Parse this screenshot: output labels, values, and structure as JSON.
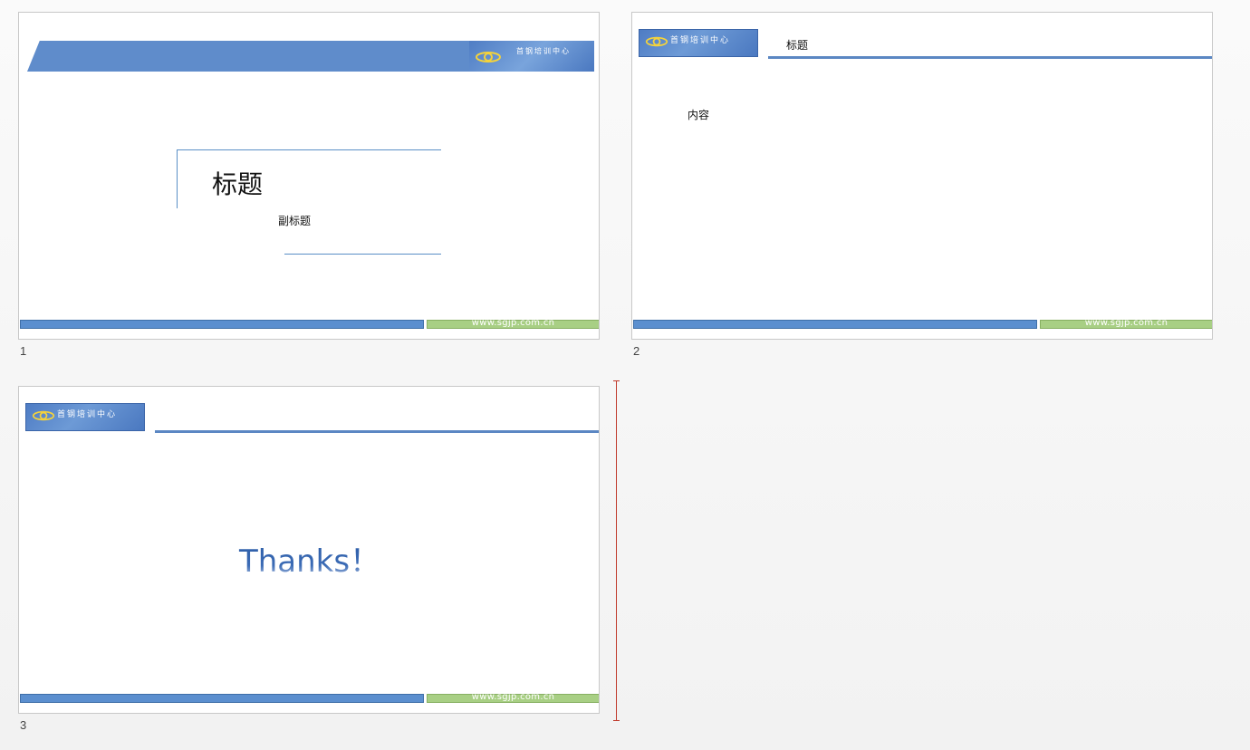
{
  "slides": [
    {
      "number": "1",
      "title": "标题",
      "subtitle": "副标题",
      "footer_url": "www.sgjp.com.cn",
      "logo_text": "首钢培训中心"
    },
    {
      "number": "2",
      "title": "标题",
      "content": "内容",
      "footer_url": "www.sgjp.com.cn",
      "logo_text": "首钢培训中心"
    },
    {
      "number": "3",
      "body": "Thanks！",
      "footer_url": "www.sgjp.com.cn",
      "logo_text": "首钢培训中心"
    }
  ],
  "colors": {
    "banner_blue": "#5f8ccb",
    "footer_blue": "#5b8fcf",
    "footer_green": "#a8cf84",
    "insertion_marker": "#c0392b"
  }
}
